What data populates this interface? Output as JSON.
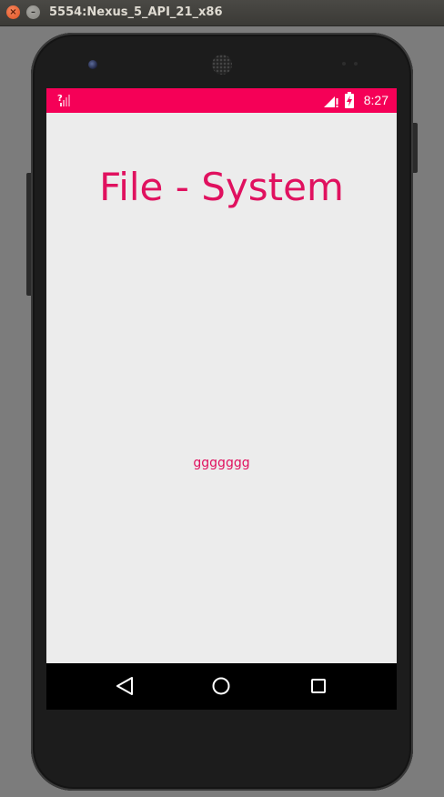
{
  "window": {
    "title": "5554:Nexus_5_API_21_x86",
    "close_icon": "×",
    "minimize_icon": "–"
  },
  "status_bar": {
    "time": "8:27",
    "color": "#f50057",
    "icons": [
      "sim-unknown-icon",
      "cell-signal-icon",
      "battery-charging-icon"
    ]
  },
  "app": {
    "title": "File - System",
    "text": "ggggggg",
    "accent_color": "#e0115f",
    "background": "#ececec"
  },
  "nav_bar": {
    "buttons": [
      "back-icon",
      "home-icon",
      "recents-icon"
    ]
  }
}
